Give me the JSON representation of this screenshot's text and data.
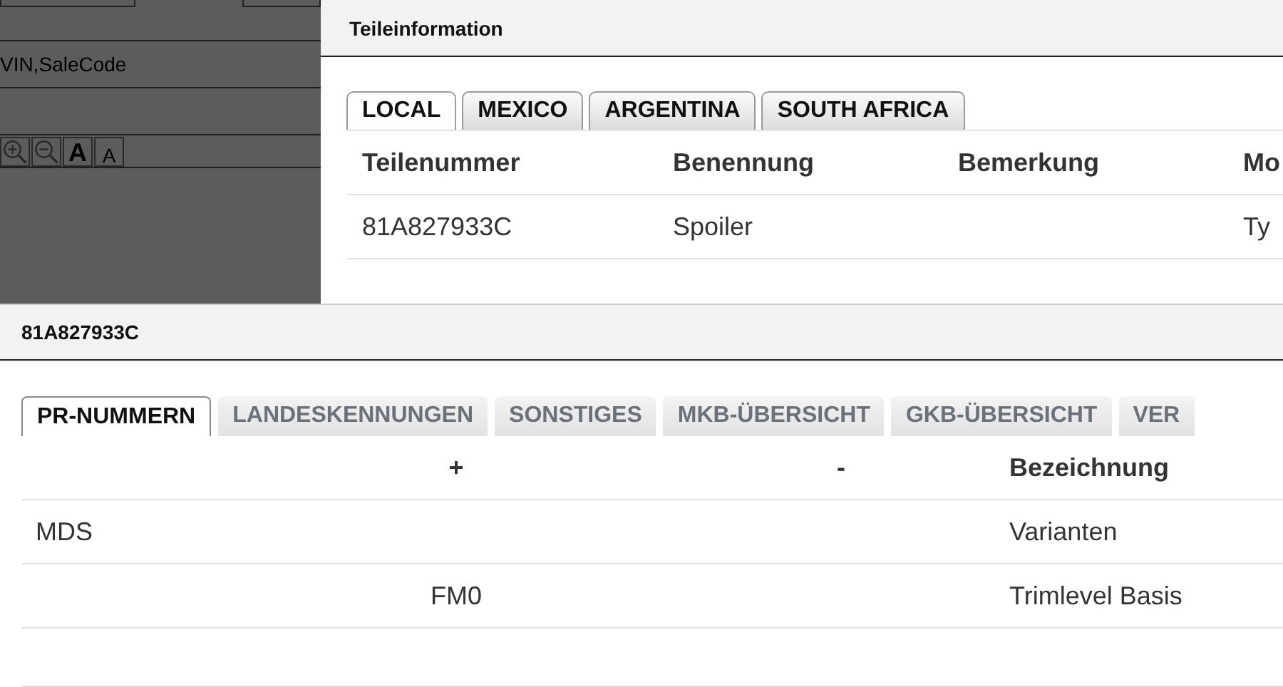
{
  "background": {
    "search_hint": "VIN,SaleCode",
    "toolbar": [
      {
        "kind": "zoom-in"
      },
      {
        "kind": "zoom-out"
      },
      {
        "kind": "font-up",
        "label": "A"
      },
      {
        "kind": "font-down",
        "label": "A"
      }
    ]
  },
  "parts_dialog": {
    "title": "Teileinformation",
    "tabs": [
      {
        "label": "LOCAL",
        "selected": true
      },
      {
        "label": "MEXICO",
        "selected": false
      },
      {
        "label": "ARGENTINA",
        "selected": false
      },
      {
        "label": "SOUTH AFRICA",
        "selected": false
      }
    ],
    "columns": [
      "Teilenummer",
      "Benennung",
      "Bemerkung",
      "Mo"
    ],
    "rows": [
      [
        "81A827933C",
        "Spoiler",
        "",
        "Ty"
      ]
    ]
  },
  "pr_dialog": {
    "title": "81A827933C",
    "tabs": [
      {
        "label": "PR-NUMMERN",
        "selected": true
      },
      {
        "label": "LANDESKENNUNGEN",
        "selected": false
      },
      {
        "label": "SONSTIGES",
        "selected": false
      },
      {
        "label": "MKB-ÜBERSICHT",
        "selected": false
      },
      {
        "label": "GKB-ÜBERSICHT",
        "selected": false
      },
      {
        "label": "VER",
        "selected": false
      }
    ],
    "columns": [
      "",
      "+",
      "-",
      "Bezeichnung"
    ],
    "rows": [
      [
        "MDS",
        "",
        "",
        "Varianten"
      ],
      [
        "",
        "FM0",
        "",
        "Trimlevel Basis"
      ]
    ]
  }
}
